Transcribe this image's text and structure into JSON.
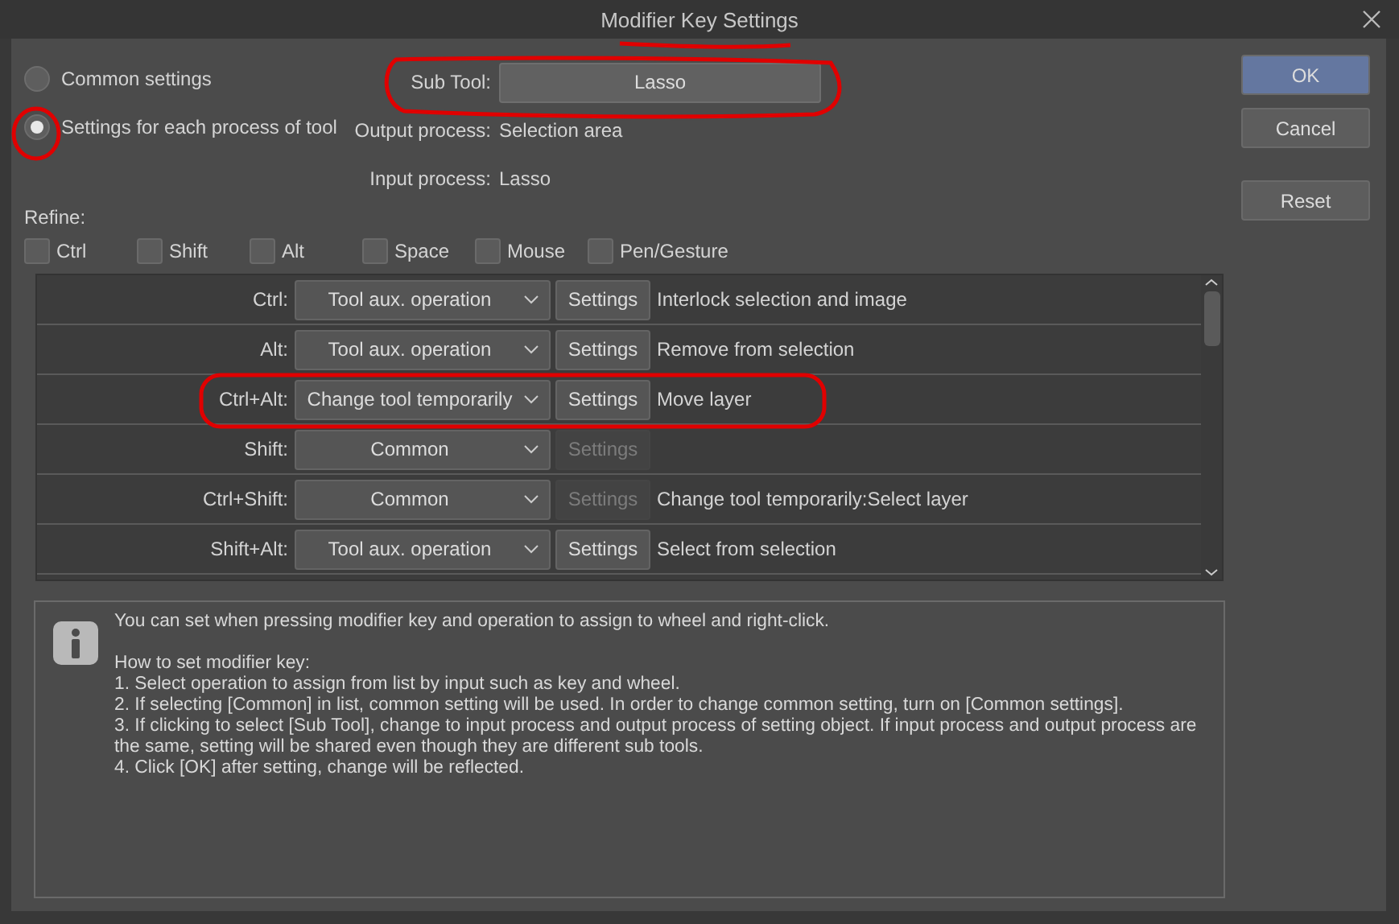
{
  "window": {
    "title": "Modifier Key Settings"
  },
  "mode": [
    {
      "label": "Common settings",
      "selected": false
    },
    {
      "label": "Settings for each process of tool",
      "selected": true
    }
  ],
  "sub_tool": {
    "label": "Sub Tool:",
    "value": "Lasso"
  },
  "processes": [
    {
      "label": "Output process:",
      "value": "Selection area"
    },
    {
      "label": "Input process:",
      "value": "Lasso"
    }
  ],
  "refine": {
    "label": "Refine:",
    "options": [
      {
        "label": "Ctrl",
        "checked": false
      },
      {
        "label": "Shift",
        "checked": false
      },
      {
        "label": "Alt",
        "checked": false
      },
      {
        "label": "Space",
        "checked": false
      },
      {
        "label": "Mouse",
        "checked": false
      },
      {
        "label": "Pen/Gesture",
        "checked": false
      }
    ]
  },
  "table": {
    "rows": [
      {
        "key": "Ctrl:",
        "operation": "Tool aux. operation",
        "settings_label": "Settings",
        "settings_enabled": true,
        "description": "Interlock selection and image"
      },
      {
        "key": "Alt:",
        "operation": "Tool aux. operation",
        "settings_label": "Settings",
        "settings_enabled": true,
        "description": "Remove from selection"
      },
      {
        "key": "Ctrl+Alt:",
        "operation": "Change tool temporarily",
        "settings_label": "Settings",
        "settings_enabled": true,
        "description": "Move layer"
      },
      {
        "key": "Shift:",
        "operation": "Common",
        "settings_label": "Settings",
        "settings_enabled": false
      },
      {
        "key": "Ctrl+Shift:",
        "operation": "Common",
        "settings_label": "Settings",
        "settings_enabled": false,
        "description": "Change tool temporarily:Select layer"
      },
      {
        "key": "Shift+Alt:",
        "operation": "Tool aux. operation",
        "settings_label": "Settings",
        "settings_enabled": true,
        "description": "Select from selection"
      }
    ]
  },
  "info": {
    "intro": "You can set when pressing modifier key and operation to assign to wheel and right-click.",
    "heading": "How to set modifier key:",
    "steps": [
      "1. Select operation to assign from list by input such as key and wheel.",
      "2. If selecting [Common] in list, common setting will be used. In order to change common setting, turn on [Common settings].",
      "3. If clicking to select [Sub Tool], change to input process and output process of setting object. If input process and output process are the same, setting will be shared even though they are different sub tools.",
      "4. Click [OK] after setting, change will be reflected."
    ]
  },
  "buttons": [
    {
      "label": "OK",
      "kind": "primary"
    },
    {
      "label": "Cancel",
      "kind": "normal"
    },
    {
      "label": "Reset",
      "kind": "normal"
    }
  ]
}
